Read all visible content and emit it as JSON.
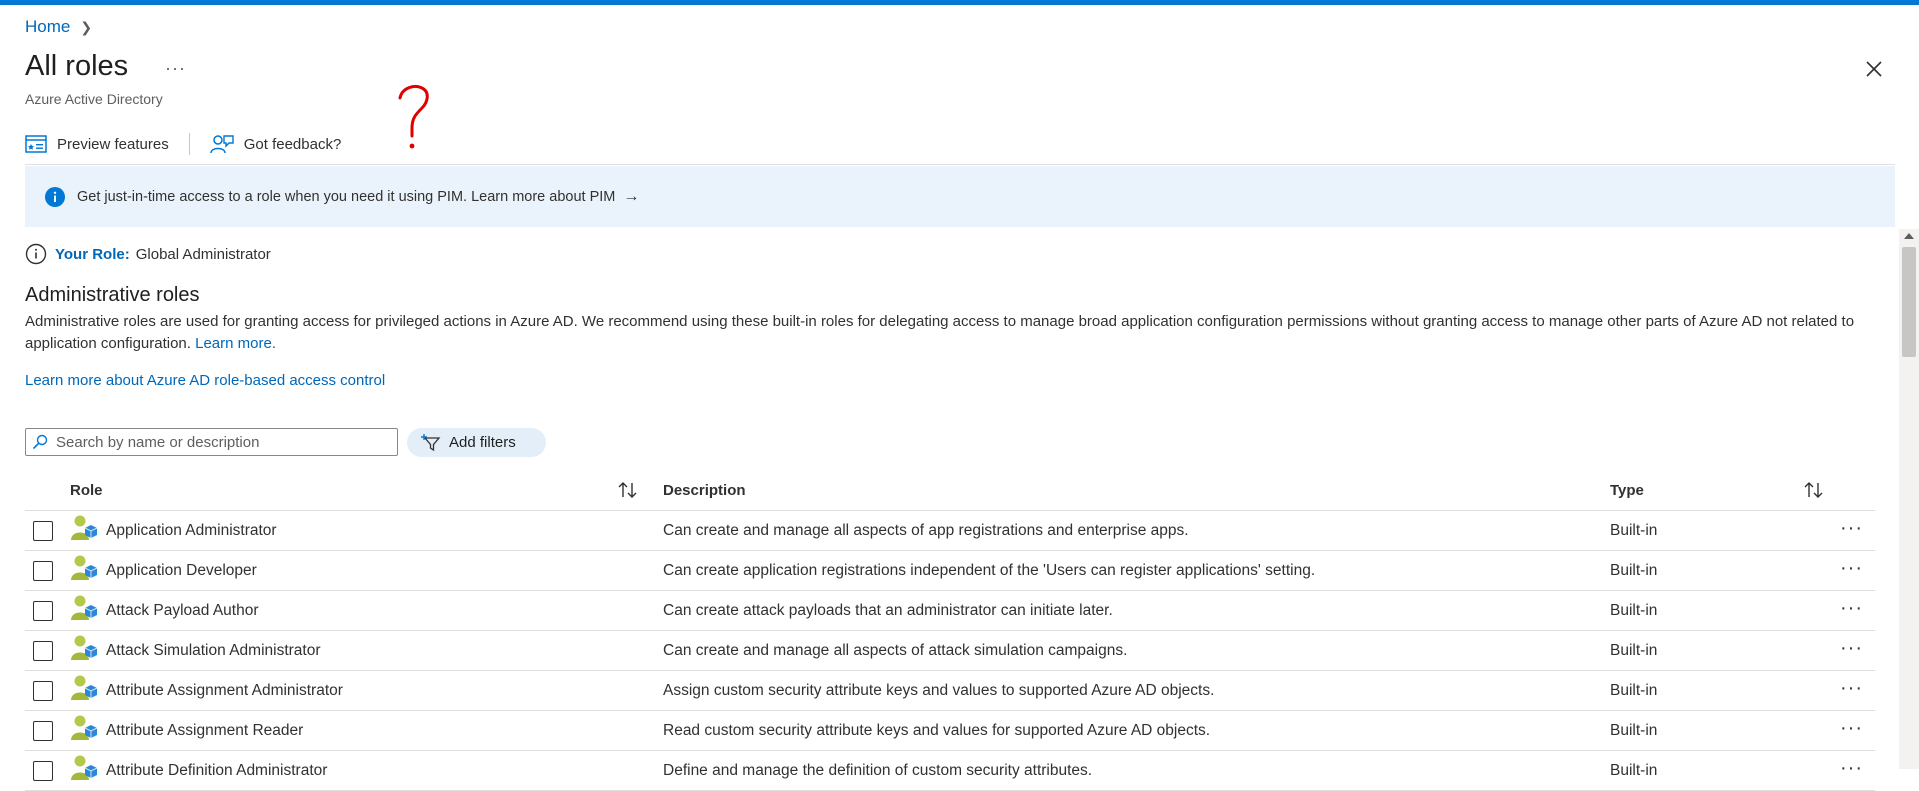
{
  "breadcrumb": {
    "home": "Home"
  },
  "header": {
    "title": "All roles",
    "more": "···",
    "subtitle": "Azure Active Directory"
  },
  "toolbar": {
    "preview_label": "Preview features",
    "feedback_label": "Got feedback?"
  },
  "banner": {
    "text": "Get just-in-time access to a role when you need it using PIM. Learn more about PIM",
    "arrow": "→"
  },
  "your_role": {
    "label": "Your Role:",
    "value": "Global Administrator"
  },
  "section": {
    "title": "Administrative roles",
    "description": "Administrative roles are used for granting access for privileged actions in Azure AD. We recommend using these built-in roles for delegating access to manage broad application configuration permissions without granting access to manage other parts of Azure AD not related to application configuration.",
    "learn_more": "Learn more.",
    "rbac_link": "Learn more about Azure AD role-based access control"
  },
  "search": {
    "placeholder": "Search by name or description"
  },
  "filters": {
    "label": "Add filters"
  },
  "table": {
    "headers": {
      "role": "Role",
      "description": "Description",
      "type": "Type"
    },
    "rows": [
      {
        "role": "Application Administrator",
        "description": "Can create and manage all aspects of app registrations and enterprise apps.",
        "type": "Built-in"
      },
      {
        "role": "Application Developer",
        "description": "Can create application registrations independent of the 'Users can register applications' setting.",
        "type": "Built-in"
      },
      {
        "role": "Attack Payload Author",
        "description": "Can create attack payloads that an administrator can initiate later.",
        "type": "Built-in"
      },
      {
        "role": "Attack Simulation Administrator",
        "description": "Can create and manage all aspects of attack simulation campaigns.",
        "type": "Built-in"
      },
      {
        "role": "Attribute Assignment Administrator",
        "description": "Assign custom security attribute keys and values to supported Azure AD objects.",
        "type": "Built-in"
      },
      {
        "role": "Attribute Assignment Reader",
        "description": "Read custom security attribute keys and values for supported Azure AD objects.",
        "type": "Built-in"
      },
      {
        "role": "Attribute Definition Administrator",
        "description": "Define and manage the definition of custom security attributes.",
        "type": "Built-in"
      }
    ]
  },
  "colors": {
    "accent": "#0078d4",
    "link": "#0067b8",
    "banner_bg": "#eaf3fc",
    "annotation": "#e00000"
  },
  "icons": {
    "close": "close-icon",
    "preview": "preview-features-icon",
    "feedback": "feedback-icon",
    "info": "info-icon",
    "search": "search-icon",
    "filter": "filter-icon",
    "sort": "sort-icon",
    "role": "role-icon"
  }
}
